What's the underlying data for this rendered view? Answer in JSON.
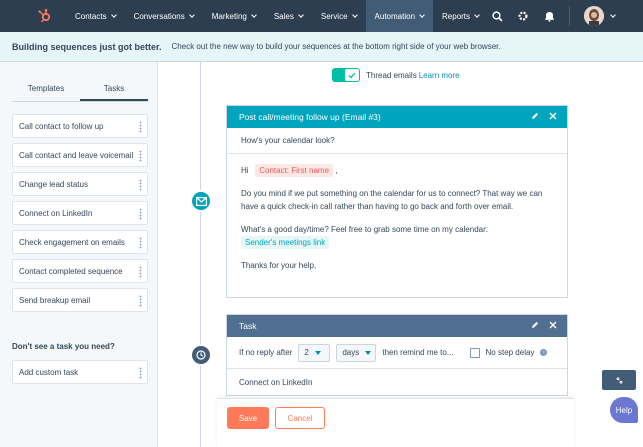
{
  "nav": {
    "items": [
      {
        "label": "Contacts",
        "active": false
      },
      {
        "label": "Conversations",
        "active": false
      },
      {
        "label": "Marketing",
        "active": false
      },
      {
        "label": "Sales",
        "active": false
      },
      {
        "label": "Service",
        "active": false
      },
      {
        "label": "Automation",
        "active": true
      },
      {
        "label": "Reports",
        "active": false
      }
    ],
    "icons": [
      "search-icon",
      "gear-icon",
      "bell-icon"
    ],
    "brand_color": "#ff7a59",
    "bg_color": "#2d3e50"
  },
  "banner": {
    "title": "Building sequences just got better.",
    "text": "Check out the new way to build your sequences at the bottom right side of your web browser."
  },
  "sidebar": {
    "tabs": [
      {
        "label": "Templates",
        "active": false
      },
      {
        "label": "Tasks",
        "active": true
      }
    ],
    "tasks": [
      "Call contact to follow up",
      "Call contact and leave voicemail",
      "Change lead status",
      "Connect on LinkedIn",
      "Check engagement on emails",
      "Contact completed sequence",
      "Send breakup email"
    ],
    "dont_see": "Don't see a task you need?",
    "custom_task": "Add custom task"
  },
  "main": {
    "thread_label": "Thread emails",
    "learn_more": "Learn more",
    "thread_enabled": true,
    "email": {
      "title": "Post call/meeting follow up (Email #3)",
      "subject": "How's your calendar look?",
      "greeting": "Hi",
      "token_first_name": "Contact: First name",
      "greeting_end": ",",
      "para1": "Do you mind if we put something on the calendar for us to connect? That way we can have a quick check-in call rather than having to go back and forth over email.",
      "para2_a": "What's a good day/time? Feel free to grab some time on my calendar:",
      "token_meetings": "Sender's meetings link",
      "sign_off": "Thanks for your help,"
    },
    "task": {
      "title": "Task",
      "if_no_reply": "If no reply after",
      "count": "2",
      "unit": "days",
      "then_remind": "then remind me to...",
      "no_step_delay": "No step delay",
      "task_type": "Connect on LinkedIn"
    }
  },
  "footer": {
    "save": "Save",
    "cancel": "Cancel"
  },
  "help": "Help"
}
